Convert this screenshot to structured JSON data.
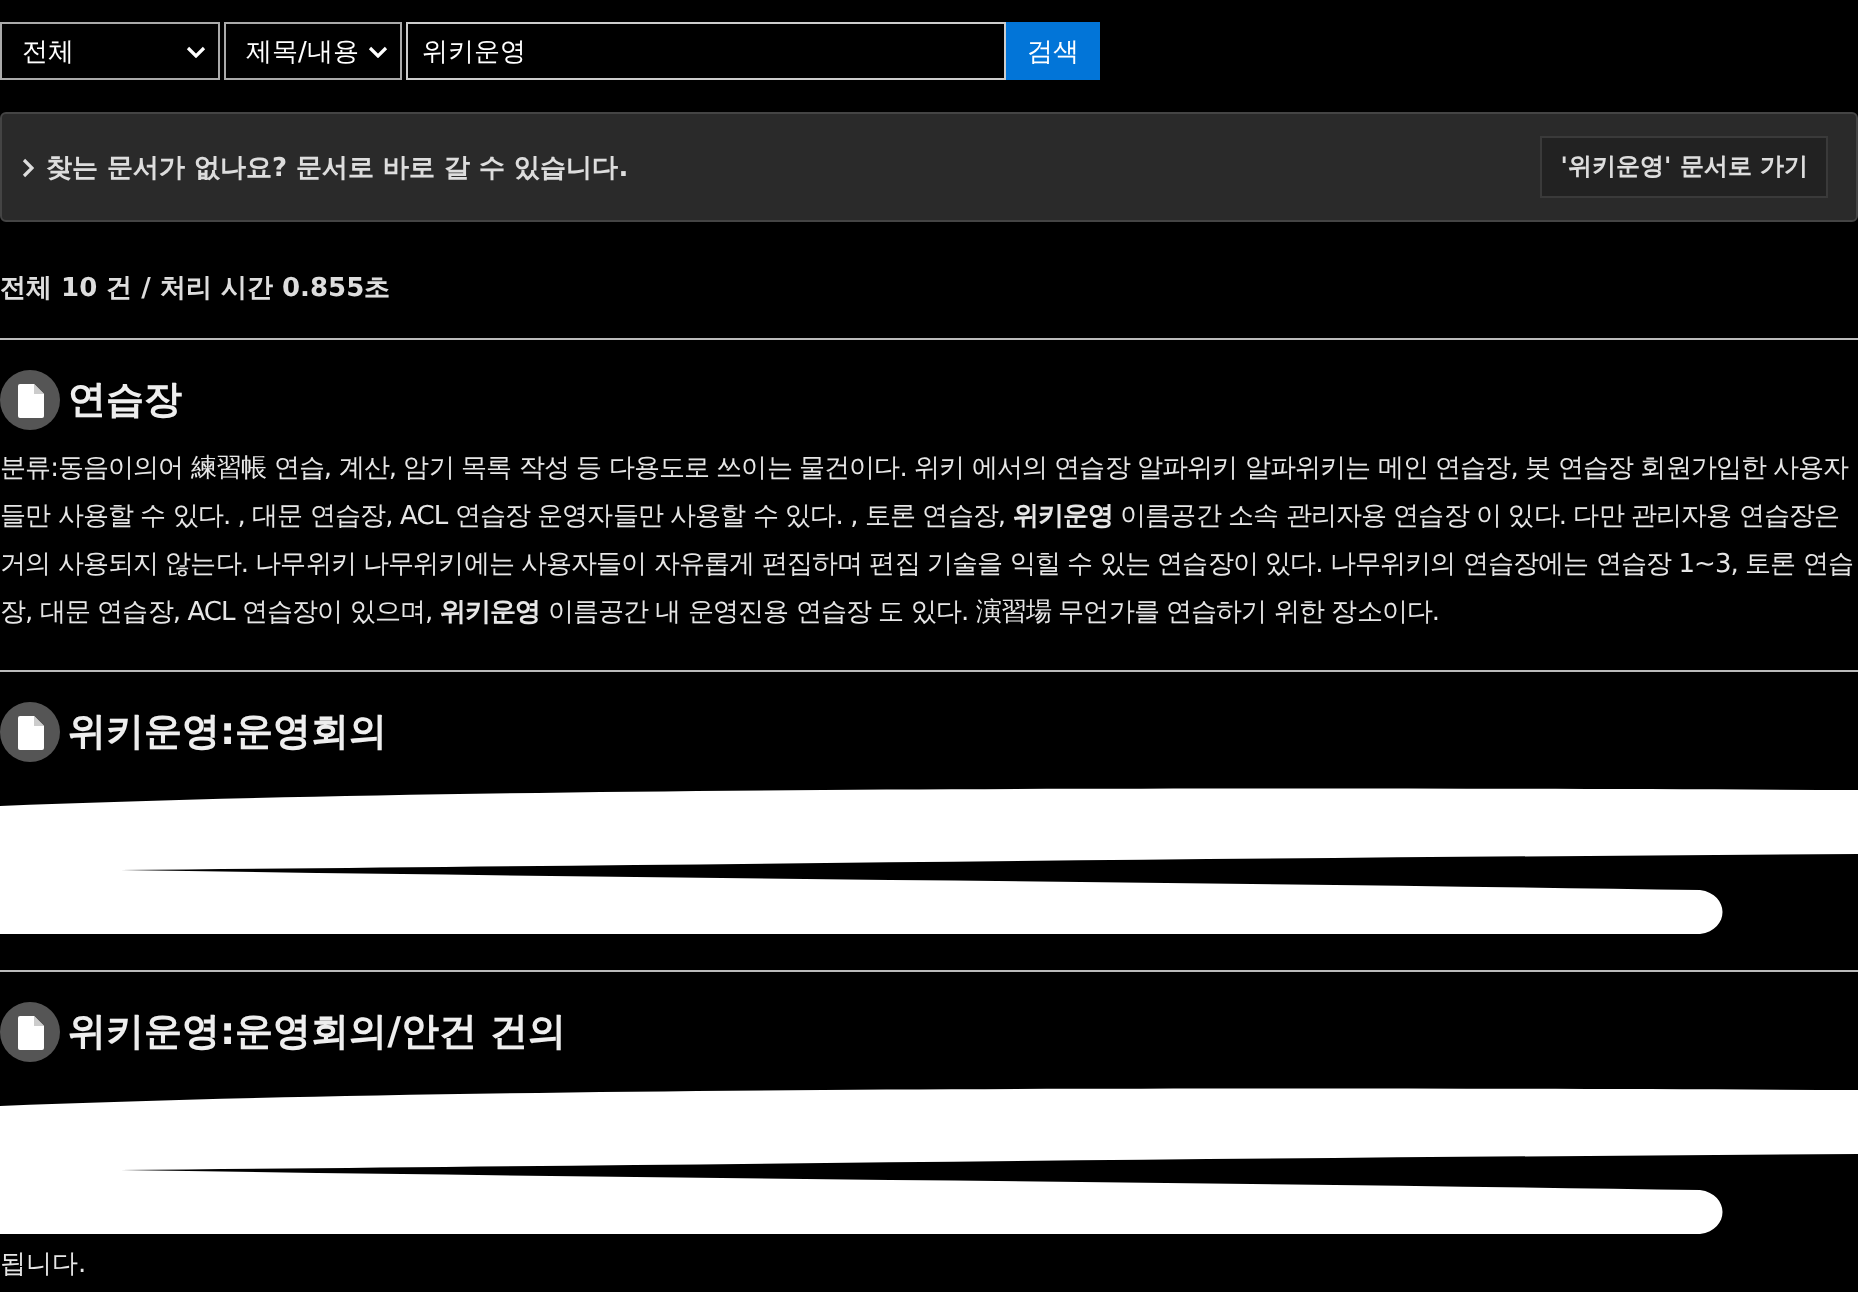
{
  "search": {
    "scope": "전체",
    "field": "제목/내용",
    "query": "위키운영",
    "button": "검색"
  },
  "notice": {
    "text": "찾는 문서가 없나요? 문서로 바로 갈 수 있습니다.",
    "button": "'위키운영' 문서로 가기"
  },
  "summary": "전체 10 건 / 처리 시간 0.855초",
  "results": [
    {
      "kind": "text",
      "title": "연습장",
      "body": "분류:동음이의어 練習帳 연습, 계산, 암기 목록 작성 등 다용도로 쓰이는 물건이다. 위키 에서의 연습장 알파위키 알파위키는 메인 연습장, 봇 연습장 회원가입한 사용자들만 사용할 수 있다. , 대문 연습장, ACL 연습장 운영자들만 사용할 수 있다. , 토론 연습장, **위키운영** 이름공간 소속 관리자용 연습장 이 있다. 다만 관리자용 연습장은 거의 사용되지 않는다. 나무위키 나무위키에는 사용자들이 자유롭게 편집하며 편집 기술을 익힐 수 있는 연습장이 있다. 나무위키의 연습장에는 연습장 1~3, 토론 연습장, 대문 연습장, ACL 연습장이 있으며, **위키운영** 이름공간 내 운영진용 연습장 도 있다. 演習場 무언가를 연습하기 위한 장소이다."
    },
    {
      "kind": "redacted",
      "title": "위키운영:운영회의"
    },
    {
      "kind": "redacted",
      "title": "위키운영:운영회의/안건 건의",
      "tail": "됩니다."
    }
  ]
}
